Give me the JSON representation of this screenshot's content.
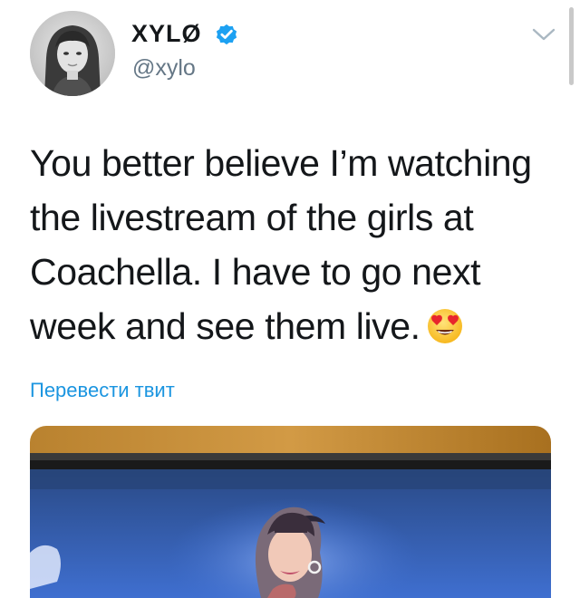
{
  "user": {
    "display_name": "XYLØ",
    "handle": "@xylo",
    "verified": true,
    "avatar_icon": "profile-photo"
  },
  "tweet": {
    "text_lines": [
      "You better believe I’m watching",
      "the livestream of the girls at",
      "Coachella. I have to go next",
      "week and see them live."
    ],
    "emoji": "heart-eyes-emoji"
  },
  "actions": {
    "translate_label": "Перевести твит",
    "menu_icon": "chevron-down-icon"
  },
  "colors": {
    "text": "#14171a",
    "secondary_text": "#657786",
    "link": "#1b95e0",
    "verified_badge": "#1da1f2"
  }
}
